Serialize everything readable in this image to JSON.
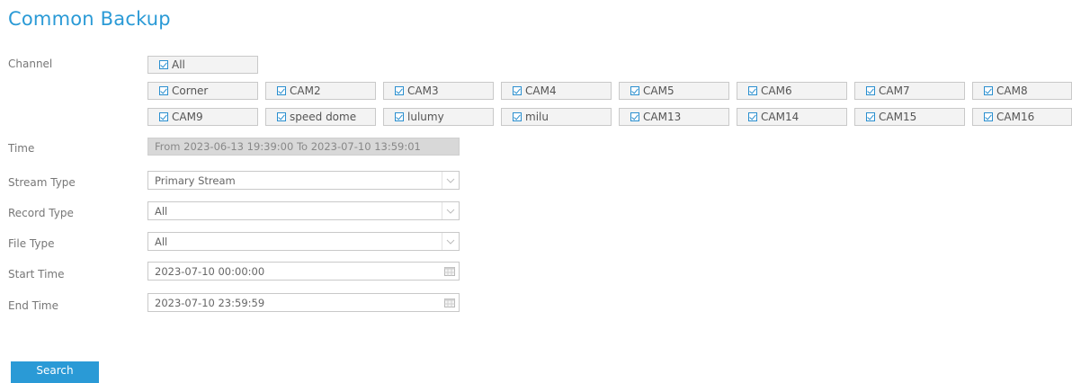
{
  "page": {
    "title": "Common Backup"
  },
  "labels": {
    "channel": "Channel",
    "time": "Time",
    "stream_type": "Stream Type",
    "record_type": "Record Type",
    "file_type": "File Type",
    "start_time": "Start Time",
    "end_time": "End Time"
  },
  "channels": {
    "all": {
      "label": "All",
      "checked": true
    },
    "row1": [
      {
        "label": "Corner",
        "checked": true
      },
      {
        "label": "CAM2",
        "checked": true
      },
      {
        "label": "CAM3",
        "checked": true
      },
      {
        "label": "CAM4",
        "checked": true
      },
      {
        "label": "CAM5",
        "checked": true
      },
      {
        "label": "CAM6",
        "checked": true
      },
      {
        "label": "CAM7",
        "checked": true
      },
      {
        "label": "CAM8",
        "checked": true
      }
    ],
    "row2": [
      {
        "label": "CAM9",
        "checked": true
      },
      {
        "label": "speed dome",
        "checked": true
      },
      {
        "label": "lulumy",
        "checked": true
      },
      {
        "label": "milu",
        "checked": true
      },
      {
        "label": "CAM13",
        "checked": true
      },
      {
        "label": "CAM14",
        "checked": true
      },
      {
        "label": "CAM15",
        "checked": true
      },
      {
        "label": "CAM16",
        "checked": true
      }
    ]
  },
  "time_range": "From 2023-06-13 19:39:00 To 2023-07-10 13:59:01",
  "stream_type": {
    "value": "Primary Stream"
  },
  "record_type": {
    "value": "All"
  },
  "file_type": {
    "value": "All"
  },
  "start_time": {
    "value": "2023-07-10 00:00:00"
  },
  "end_time": {
    "value": "2023-07-10 23:59:59"
  },
  "actions": {
    "search_label": "Search"
  },
  "colors": {
    "accent": "#2a9ad6",
    "checkbox": "#2a8fcf",
    "field_border": "#c9c9c9",
    "disabled_bg": "#d8d8d8"
  },
  "icons": {
    "checkbox": "checkbox-checked-icon",
    "select": "chevron-down-icon",
    "calendar": "calendar-icon"
  }
}
